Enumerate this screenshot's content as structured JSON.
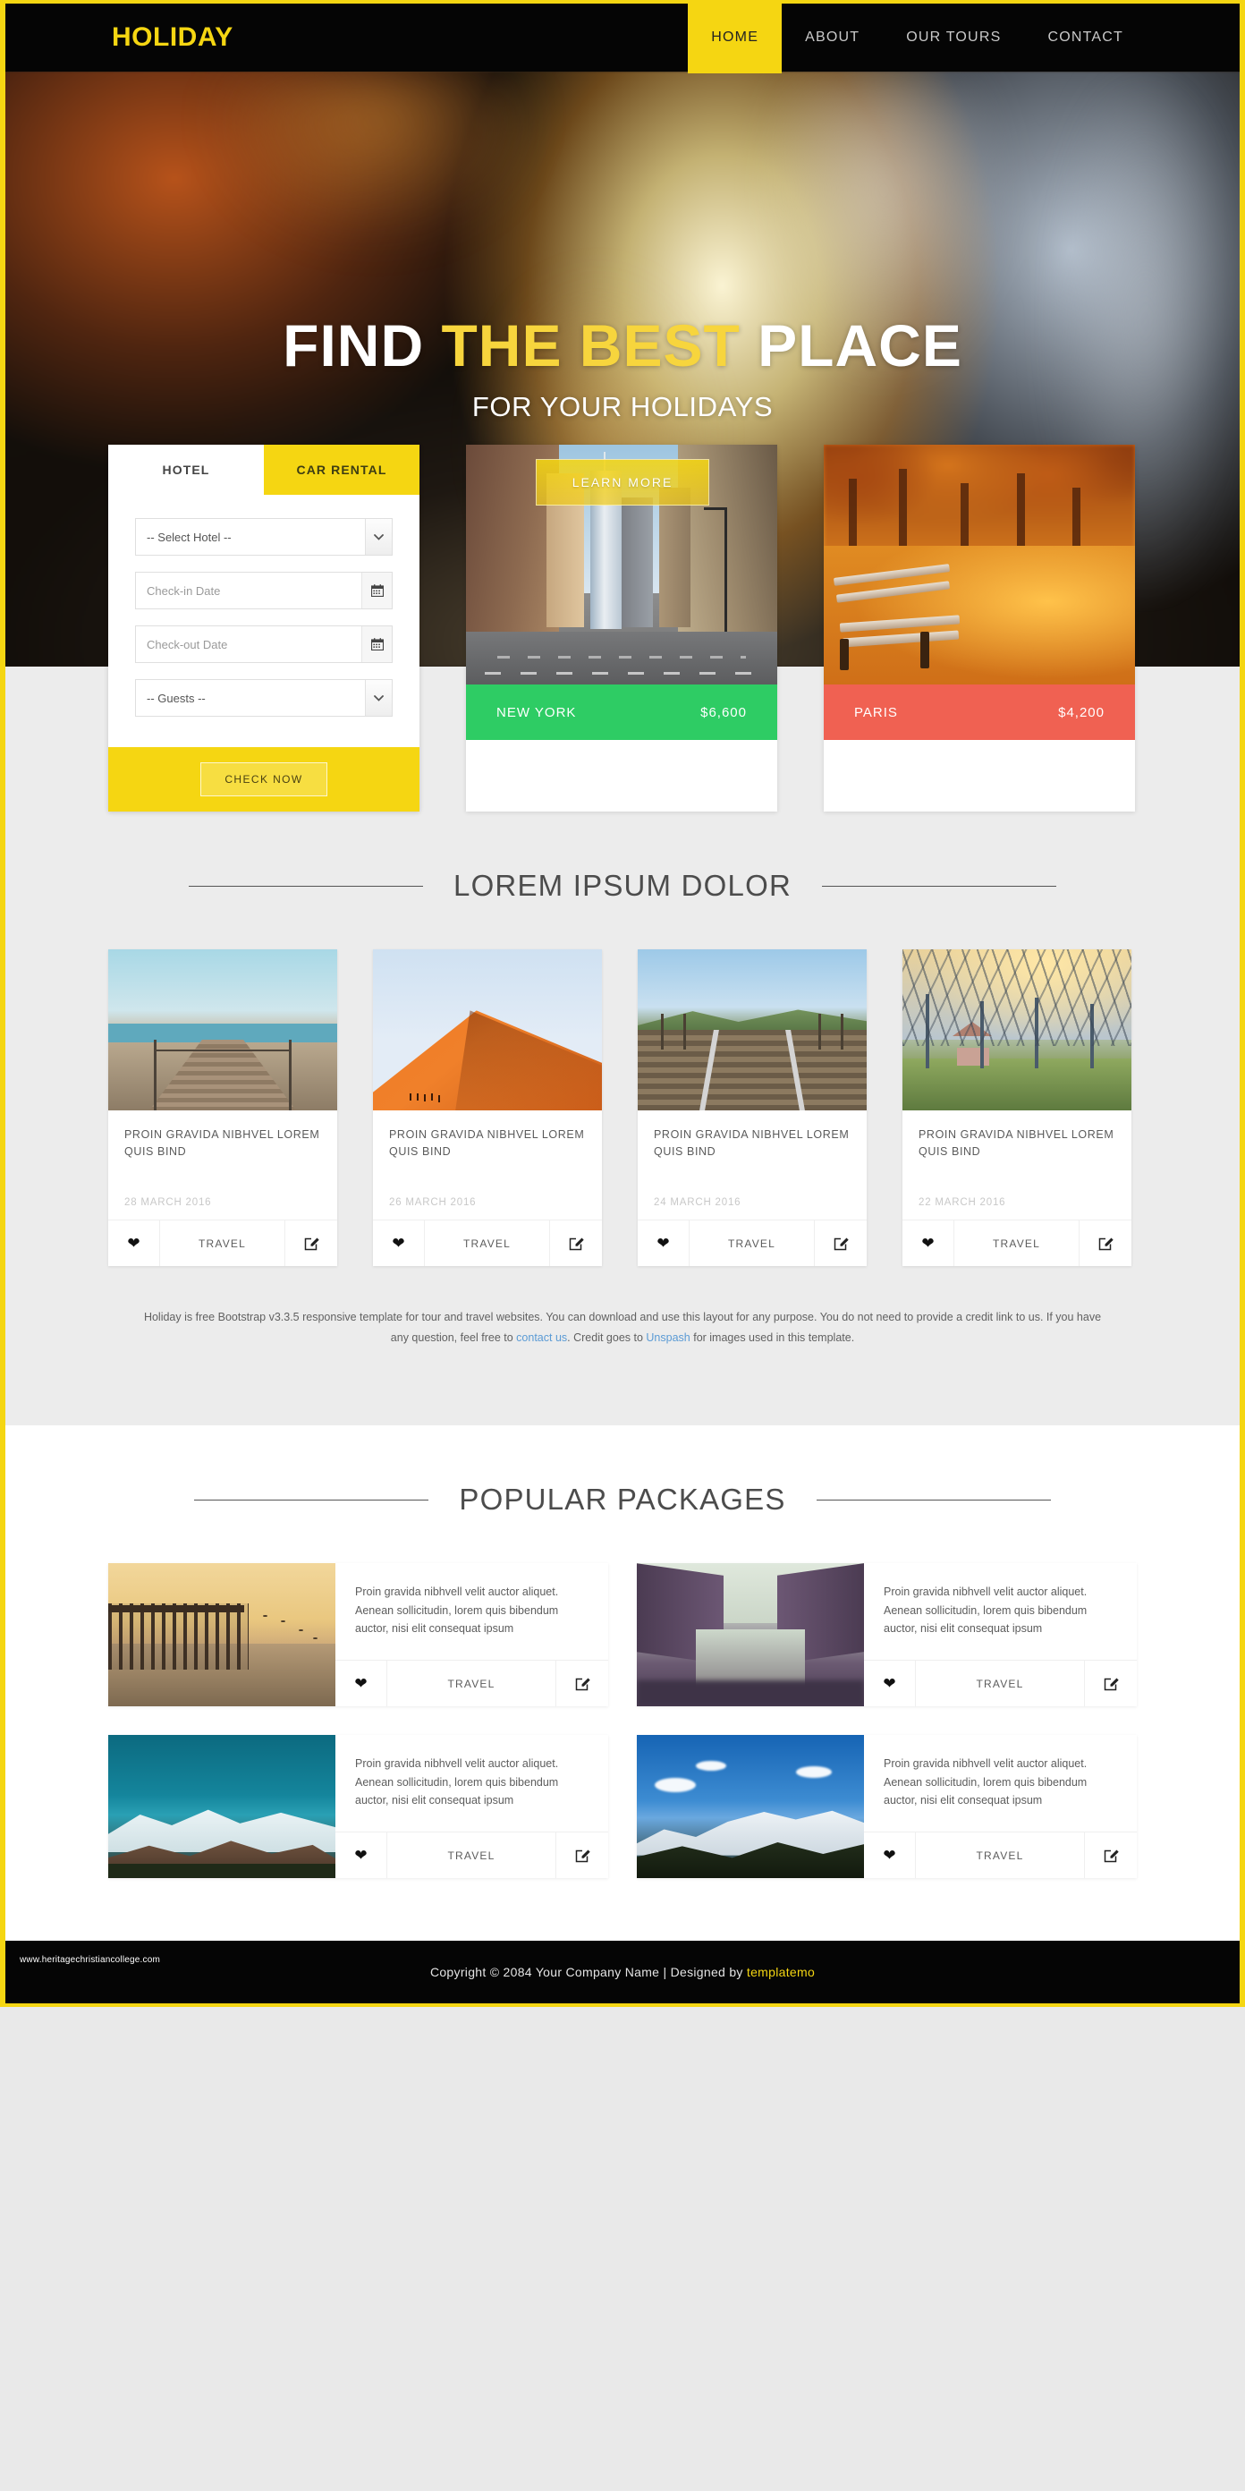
{
  "brand": {
    "name": "HOLIDAY"
  },
  "nav": {
    "items": [
      {
        "label": "HOME",
        "active": true
      },
      {
        "label": "ABOUT",
        "active": false
      },
      {
        "label": "OUR TOURS",
        "active": false
      },
      {
        "label": "CONTACT",
        "active": false
      }
    ]
  },
  "hero": {
    "title_part1": "FIND ",
    "title_highlight": "THE BEST",
    "title_part2": " PLACE",
    "subtitle": "FOR YOUR HOLIDAYS",
    "button": "LEARN MORE",
    "accent_color": "#f7d53d"
  },
  "booking": {
    "tabs": [
      {
        "label": "HOTEL",
        "active": true
      },
      {
        "label": "CAR RENTAL",
        "active": false
      }
    ],
    "hotel_select": "-- Select Hotel --",
    "checkin_placeholder": "Check-in Date",
    "checkout_placeholder": "Check-out Date",
    "guests_select": "-- Guests --",
    "submit": "CHECK NOW",
    "calendar_icon": "calendar-icon",
    "chevron_icon": "chevron-down-icon",
    "accent_color": "#f5d612"
  },
  "destinations": [
    {
      "name": "NEW YORK",
      "price": "$6,600",
      "bar_color": "#2ecc64",
      "image": "new-york-street-skyline"
    },
    {
      "name": "PARIS",
      "price": "$4,200",
      "bar_color": "#f06152",
      "image": "paris-autumn-park-bench"
    }
  ],
  "blog_section": {
    "title": "LOREM IPSUM DOLOR",
    "cards": [
      {
        "title": "PROIN GRAVIDA NIBHVEL LOREM QUIS BIND",
        "date": "28 MARCH 2016",
        "category": "TRAVEL",
        "image": "wooden-boardwalk-pier",
        "like_icon": "heart-icon",
        "edit_icon": "edit-square-icon"
      },
      {
        "title": "PROIN GRAVIDA NIBHVEL LOREM QUIS BIND",
        "date": "26 MARCH 2016",
        "category": "TRAVEL",
        "image": "orange-sand-dune",
        "like_icon": "heart-icon",
        "edit_icon": "edit-square-icon"
      },
      {
        "title": "PROIN GRAVIDA NIBHVEL LOREM QUIS BIND",
        "date": "24 MARCH 2016",
        "category": "TRAVEL",
        "image": "railway-tracks",
        "like_icon": "heart-icon",
        "edit_icon": "edit-square-icon"
      },
      {
        "title": "PROIN GRAVIDA NIBHVEL LOREM QUIS BIND",
        "date": "22 MARCH 2016",
        "category": "TRAVEL",
        "image": "tree-avenue-sunrise",
        "like_icon": "heart-icon",
        "edit_icon": "edit-square-icon"
      }
    ],
    "description_pre": "Holiday is free Bootstrap v3.3.5 responsive template for tour and travel websites. You can download and use this layout for any purpose. You do not need to provide a credit link to us. If you have any question, feel free to ",
    "description_link1": "contact us",
    "description_mid": ". Credit goes to ",
    "description_link2": "Unspash",
    "description_post": " for images used in this template."
  },
  "packages_section": {
    "title": "POPULAR PACKAGES",
    "cards": [
      {
        "text": "Proin gravida nibhvell velit auctor aliquet. Aenean sollicitudin, lorem quis bibendum auctor, nisi elit consequat ipsum",
        "category": "TRAVEL",
        "image": "sunset-pier-ruins",
        "like_icon": "heart-icon",
        "edit_icon": "edit-square-icon"
      },
      {
        "text": "Proin gravida nibhvell velit auctor aliquet. Aenean sollicitudin, lorem quis bibendum auctor, nisi elit consequat ipsum",
        "category": "TRAVEL",
        "image": "purple-canal-city",
        "like_icon": "heart-icon",
        "edit_icon": "edit-square-icon"
      },
      {
        "text": "Proin gravida nibhvell velit auctor aliquet. Aenean sollicitudin, lorem quis bibendum auctor, nisi elit consequat ipsum",
        "category": "TRAVEL",
        "image": "teal-sky-snow-mountain",
        "like_icon": "heart-icon",
        "edit_icon": "edit-square-icon"
      },
      {
        "text": "Proin gravida nibhvell velit auctor aliquet. Aenean sollicitudin, lorem quis bibendum auctor, nisi elit consequat ipsum",
        "category": "TRAVEL",
        "image": "blue-sky-snow-mountain",
        "like_icon": "heart-icon",
        "edit_icon": "edit-square-icon"
      }
    ]
  },
  "footer": {
    "site_url": "www.heritagechristiancollege.com",
    "copyright_pre": "Copyright © 2084 Your Company Name | Designed by ",
    "copyright_link": "templatemo"
  }
}
